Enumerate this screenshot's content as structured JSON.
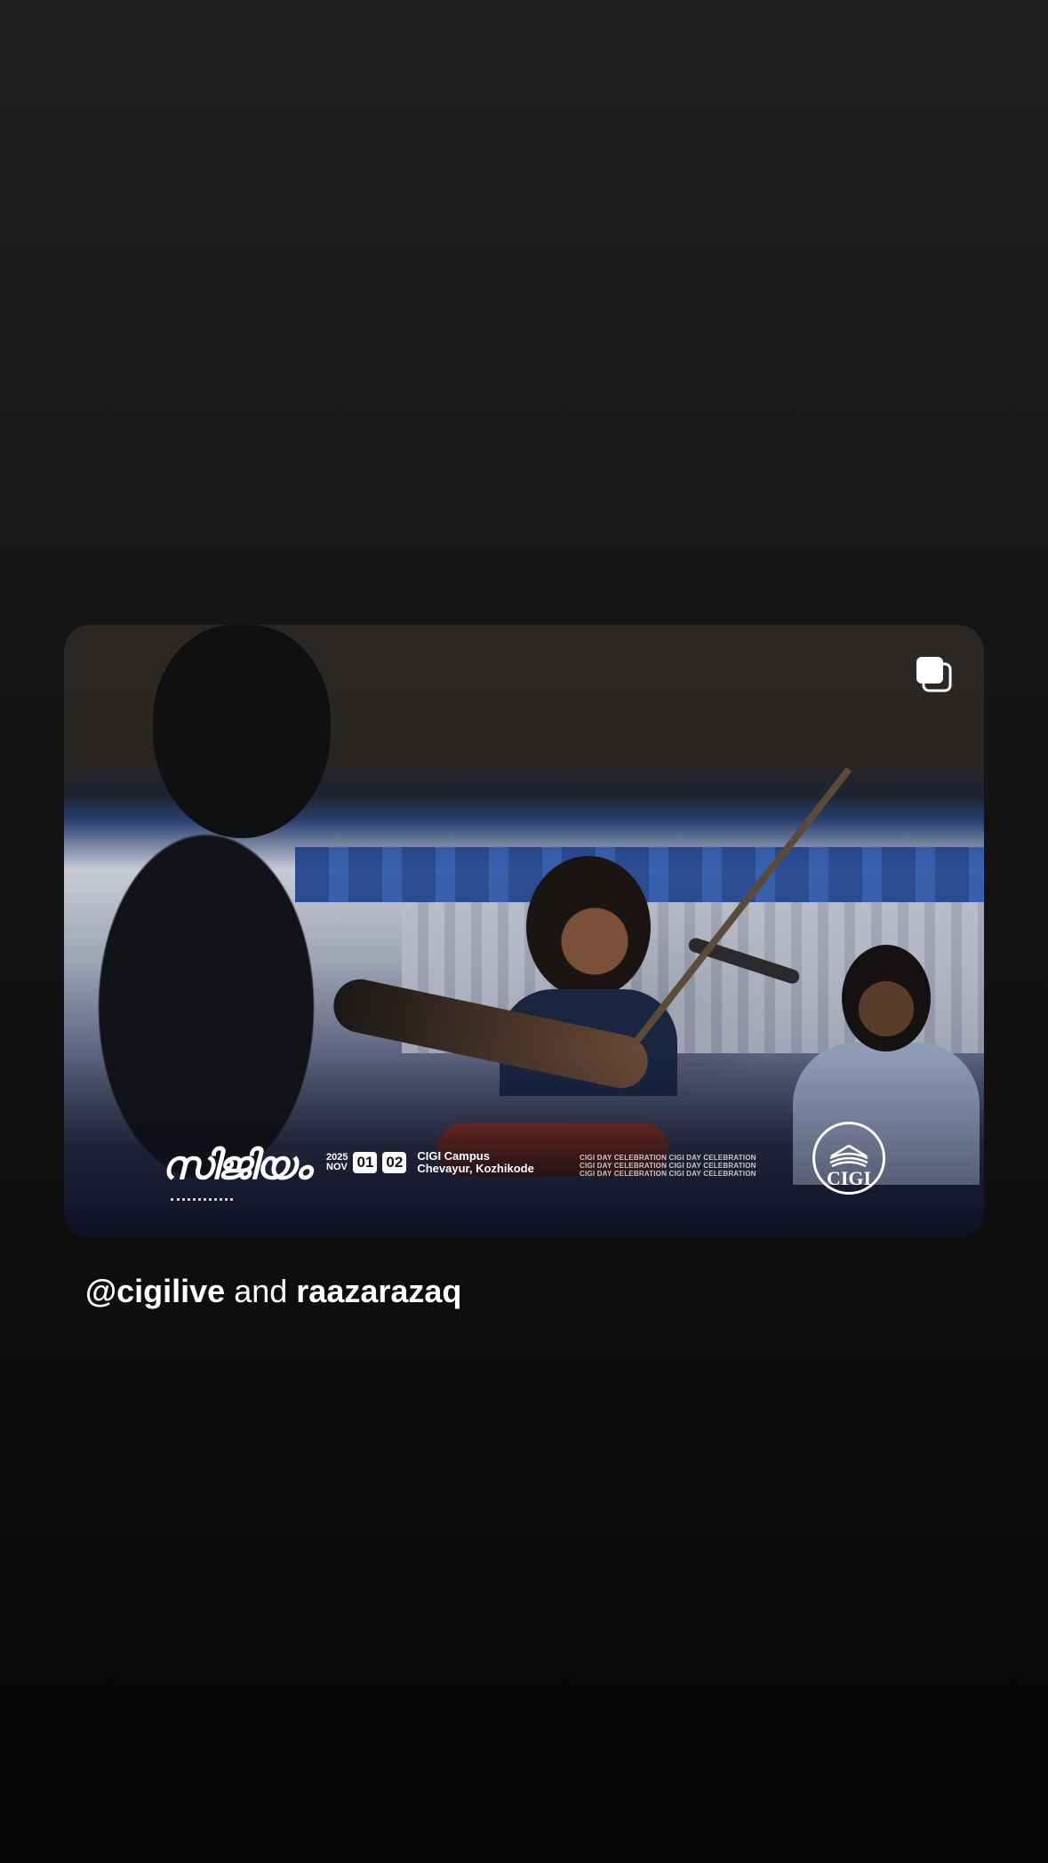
{
  "post": {
    "carousel_indicator": "multiple-photos-icon",
    "image_overlay": {
      "event_logo_text": "സിജിയം",
      "year": "2025",
      "month": "NOV",
      "day_start": "01",
      "day_end": "02",
      "venue_line1": "CIGI Campus",
      "venue_line2": "Chevayur, Kozhikode",
      "celebration_text": "CIGI DAY CELEBRATION CIGI DAY CELEBRATION",
      "org_logo_text": "CIGI"
    }
  },
  "caption": {
    "user1": "@cigilive",
    "conjunction": "and",
    "user2": "raazarazaq"
  },
  "colors": {
    "background_top": "#1f1f1f",
    "background_bottom": "#060608",
    "text": "#ffffff"
  }
}
